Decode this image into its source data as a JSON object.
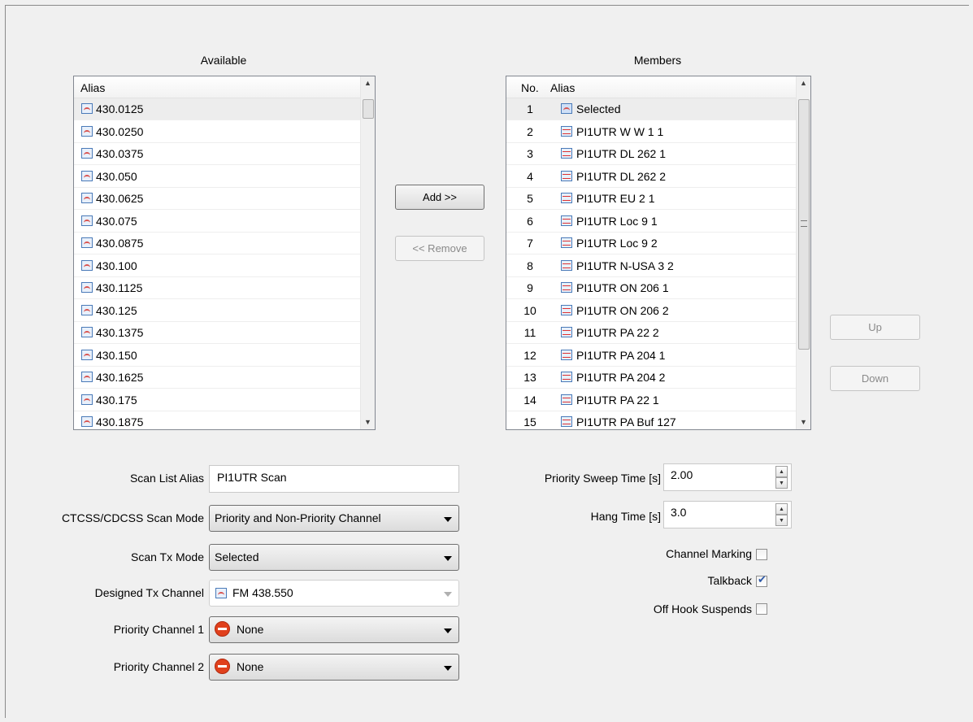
{
  "available": {
    "caption": "Available",
    "header_alias": "Alias",
    "items": [
      "430.0125",
      "430.0250",
      "430.0375",
      "430.050",
      "430.0625",
      "430.075",
      "430.0875",
      "430.100",
      "430.1125",
      "430.125",
      "430.1375",
      "430.150",
      "430.1625",
      "430.175",
      "430.1875"
    ]
  },
  "members": {
    "caption": "Members",
    "header_no": "No.",
    "header_alias": "Alias",
    "items": [
      {
        "no": "1",
        "alias": "Selected"
      },
      {
        "no": "2",
        "alias": "PI1UTR W W 1 1"
      },
      {
        "no": "3",
        "alias": "PI1UTR DL 262 1"
      },
      {
        "no": "4",
        "alias": "PI1UTR DL 262 2"
      },
      {
        "no": "5",
        "alias": "PI1UTR EU 2 1"
      },
      {
        "no": "6",
        "alias": "PI1UTR Loc 9 1"
      },
      {
        "no": "7",
        "alias": "PI1UTR Loc 9 2"
      },
      {
        "no": "8",
        "alias": "PI1UTR N-USA 3 2"
      },
      {
        "no": "9",
        "alias": "PI1UTR ON 206 1"
      },
      {
        "no": "10",
        "alias": "PI1UTR ON 206 2"
      },
      {
        "no": "11",
        "alias": "PI1UTR PA  22 2"
      },
      {
        "no": "12",
        "alias": "PI1UTR PA 204 1"
      },
      {
        "no": "13",
        "alias": "PI1UTR PA 204 2"
      },
      {
        "no": "14",
        "alias": "PI1UTR PA 22 1"
      },
      {
        "no": "15",
        "alias": "PI1UTR PA Buf 127"
      }
    ]
  },
  "buttons": {
    "add": "Add >>",
    "remove": "<< Remove",
    "up": "Up",
    "down": "Down"
  },
  "form": {
    "scan_list_alias_label": "Scan List Alias",
    "scan_list_alias_value": "PI1UTR Scan",
    "ctcss_label": "CTCSS/CDCSS Scan Mode",
    "ctcss_value": "Priority and Non-Priority Channel",
    "scan_tx_label": "Scan Tx Mode",
    "scan_tx_value": "Selected",
    "designed_tx_label": "Designed Tx Channel",
    "designed_tx_value": "FM 438.550",
    "priority1_label": "Priority Channel 1",
    "priority1_value": "None",
    "priority2_label": "Priority Channel 2",
    "priority2_value": "None",
    "sweep_label": "Priority Sweep Time [s]",
    "sweep_value": "2.00",
    "hang_label": "Hang Time [s]",
    "hang_value": "3.0",
    "channel_marking_label": "Channel Marking",
    "channel_marking_checked": false,
    "talkback_label": "Talkback",
    "talkback_checked": true,
    "offhook_label": "Off Hook Suspends",
    "offhook_checked": false
  }
}
